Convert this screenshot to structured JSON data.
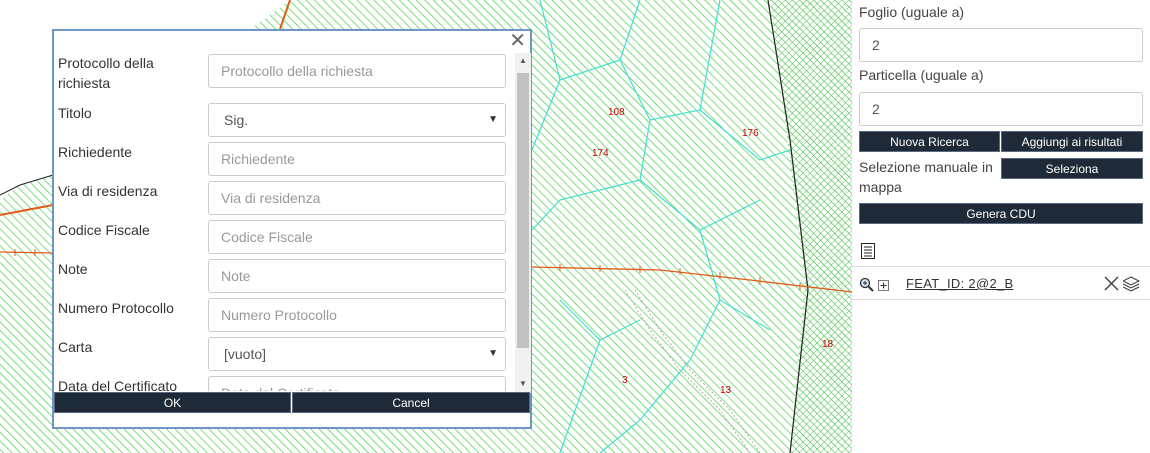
{
  "map": {
    "parcel_labels": [
      "108",
      "176",
      "174",
      "18",
      "3",
      "13"
    ]
  },
  "panel": {
    "foglio_label": "Foglio (uguale a)",
    "foglio_value": "2",
    "particella_label": "Particella (uguale a)",
    "particella_value": "2",
    "new_search_label": "Nuova Ricerca",
    "add_results_label": "Aggiungi ai risultati",
    "manual_select_label": "Selezione manuale in mappa",
    "select_button_label": "Seleziona",
    "generate_cdu_label": "Genera CDU",
    "result_feature": "FEAT_ID: 2@2_B"
  },
  "dialog": {
    "close_glyph": "✕",
    "fields": [
      {
        "label": "Protocollo della richiesta",
        "placeholder": "Protocollo della richiesta"
      },
      {
        "label": "Titolo",
        "value": "Sig."
      },
      {
        "label": "Richiedente",
        "placeholder": "Richiedente"
      },
      {
        "label": "Via di residenza",
        "placeholder": "Via di residenza"
      },
      {
        "label": "Codice Fiscale",
        "placeholder": "Codice Fiscale"
      },
      {
        "label": "Note",
        "placeholder": "Note"
      },
      {
        "label": "Numero Protocollo",
        "placeholder": "Numero Protocollo"
      },
      {
        "label": "Carta",
        "value": "[vuoto]"
      },
      {
        "label": "Data del Certificato",
        "placeholder": "Data del Certificato"
      }
    ],
    "ok_label": "OK",
    "cancel_label": "Cancel"
  },
  "colors": {
    "hatch_green": "#33cc33",
    "parcel_cyan": "#40e0d0",
    "boundary_red": "#e05a1a",
    "dialog_border": "#6d95c6",
    "button_dark": "#1f2a38"
  },
  "icons": [
    "close-icon",
    "zoom-in-icon",
    "expand-icon",
    "list-icon",
    "remove-icon",
    "layers-icon",
    "dropdown-caret-icon",
    "scroll-up-icon",
    "scroll-down-icon"
  ]
}
